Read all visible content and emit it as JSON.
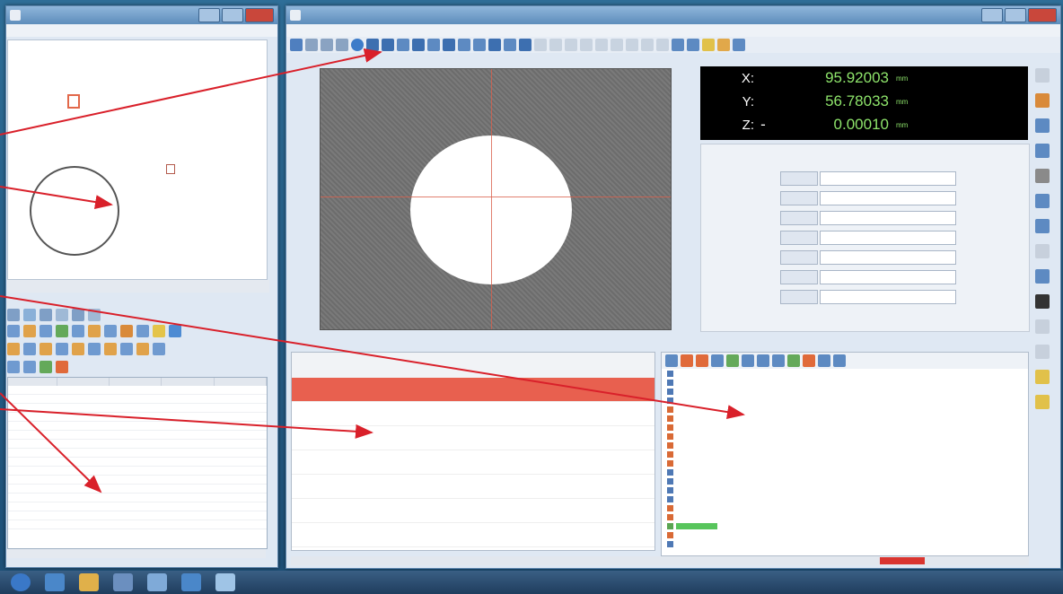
{
  "dro": {
    "x_label": "X:",
    "x_value": "95.92003",
    "x_unit": "mm",
    "y_label": "Y:",
    "y_value": "56.78033",
    "y_unit": "mm",
    "z_label": "Z:",
    "z_sign": "-",
    "z_value": "0.00010",
    "z_unit": "mm"
  },
  "colors": {
    "accent": "#d9352f",
    "annotation_arrow": "#d9202a",
    "dro_text": "#8ee46b",
    "dro_background": "#000000",
    "tree_highlight": "#58c55c",
    "crosshair": "#d9604c"
  },
  "icons": [
    "windows-start-icon",
    "browser-icon",
    "folder-icon",
    "media-icon",
    "calculator-icon",
    "app-icon",
    "measurement-app-icon"
  ]
}
